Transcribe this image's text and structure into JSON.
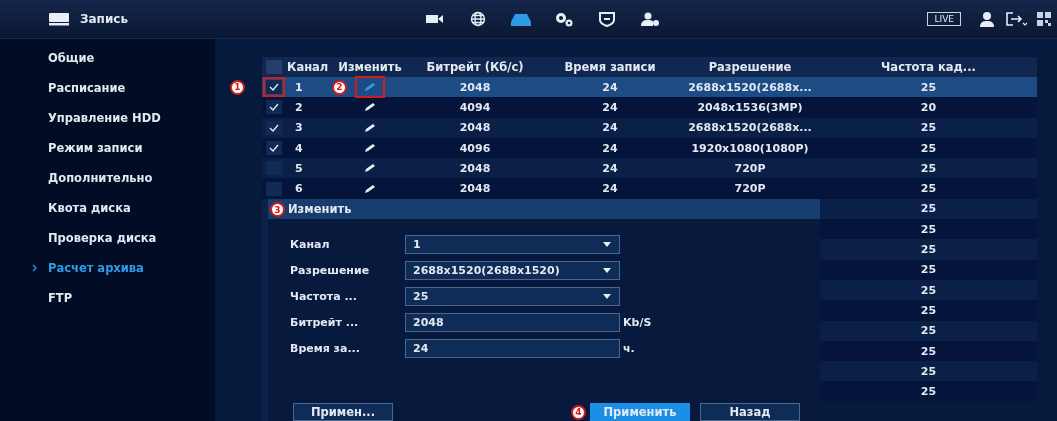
{
  "top_bar": {
    "title": "Запись",
    "nav": [
      {
        "kind": "camera",
        "selected": false
      },
      {
        "kind": "globe",
        "selected": false
      },
      {
        "kind": "storage",
        "selected": true
      },
      {
        "kind": "gears",
        "selected": false
      },
      {
        "kind": "shield",
        "selected": false
      },
      {
        "kind": "user-gear",
        "selected": false
      }
    ],
    "live_button": "LIVE"
  },
  "sidebar": {
    "items": [
      {
        "label": "Общие",
        "selected": false
      },
      {
        "label": "Расписание",
        "selected": false
      },
      {
        "label": "Управление HDD",
        "selected": false
      },
      {
        "label": "Режим записи",
        "selected": false
      },
      {
        "label": "Дополнительно",
        "selected": false
      },
      {
        "label": "Квота диска",
        "selected": false
      },
      {
        "label": "Проверка диска",
        "selected": false
      },
      {
        "label": "Расчет архива",
        "selected": true
      },
      {
        "label": "FTP",
        "selected": false
      }
    ]
  },
  "table": {
    "columns": [
      "Канал",
      "Изменить",
      "Битрейт (Кб/с)",
      "Время записи",
      "Разрешение",
      "Частота кад..."
    ],
    "select_all_checked": false,
    "rows": [
      {
        "channel": "1",
        "bitrate": "2048",
        "record_time": "24",
        "resolution": "2688x1520(2688x...",
        "frame_rate": "25",
        "checked": true,
        "selected": true,
        "check_annotation": "1",
        "edit_annotation": "2"
      },
      {
        "channel": "2",
        "bitrate": "4094",
        "record_time": "24",
        "resolution": "2048x1536(3MP)",
        "frame_rate": "20",
        "checked": true,
        "selected": false
      },
      {
        "channel": "3",
        "bitrate": "2048",
        "record_time": "24",
        "resolution": "2688x1520(2688x...",
        "frame_rate": "25",
        "checked": true,
        "selected": false
      },
      {
        "channel": "4",
        "bitrate": "4096",
        "record_time": "24",
        "resolution": "1920x1080(1080P)",
        "frame_rate": "25",
        "checked": true,
        "selected": false
      },
      {
        "channel": "5",
        "bitrate": "2048",
        "record_time": "24",
        "resolution": "720P",
        "frame_rate": "25",
        "checked": false,
        "selected": false
      },
      {
        "channel": "6",
        "bitrate": "2048",
        "record_time": "24",
        "resolution": "720P",
        "frame_rate": "25",
        "checked": false,
        "selected": false
      },
      {
        "frame_rate": "25",
        "selected": false
      },
      {
        "frame_rate": "25",
        "selected": false
      },
      {
        "frame_rate": "25",
        "selected": false
      },
      {
        "frame_rate": "25",
        "selected": false
      },
      {
        "frame_rate": "25",
        "selected": false
      },
      {
        "frame_rate": "25",
        "selected": false
      },
      {
        "frame_rate": "25",
        "selected": false
      },
      {
        "frame_rate": "25",
        "selected": false
      },
      {
        "frame_rate": "25",
        "selected": false
      },
      {
        "frame_rate": "25",
        "selected": false
      }
    ]
  },
  "dialog": {
    "title": "Изменить",
    "annotation": "3",
    "fields": [
      {
        "label": "Канал",
        "value": "1",
        "kind": "select"
      },
      {
        "label": "Разрешение",
        "value": "2688x1520(2688x1520)",
        "kind": "select"
      },
      {
        "label": "Частота ...",
        "value": "25",
        "kind": "select"
      },
      {
        "label": "Битрейт ...",
        "value": "2048",
        "kind": "input",
        "unit": "Kb/S"
      },
      {
        "label": "Время за...",
        "value": "24",
        "kind": "input",
        "unit": "ч."
      }
    ],
    "buttons": [
      {
        "label": "Примен...",
        "primary": false
      },
      {
        "label": "Применить",
        "primary": true,
        "annotation": "4"
      },
      {
        "label": "Назад",
        "primary": false
      }
    ]
  }
}
